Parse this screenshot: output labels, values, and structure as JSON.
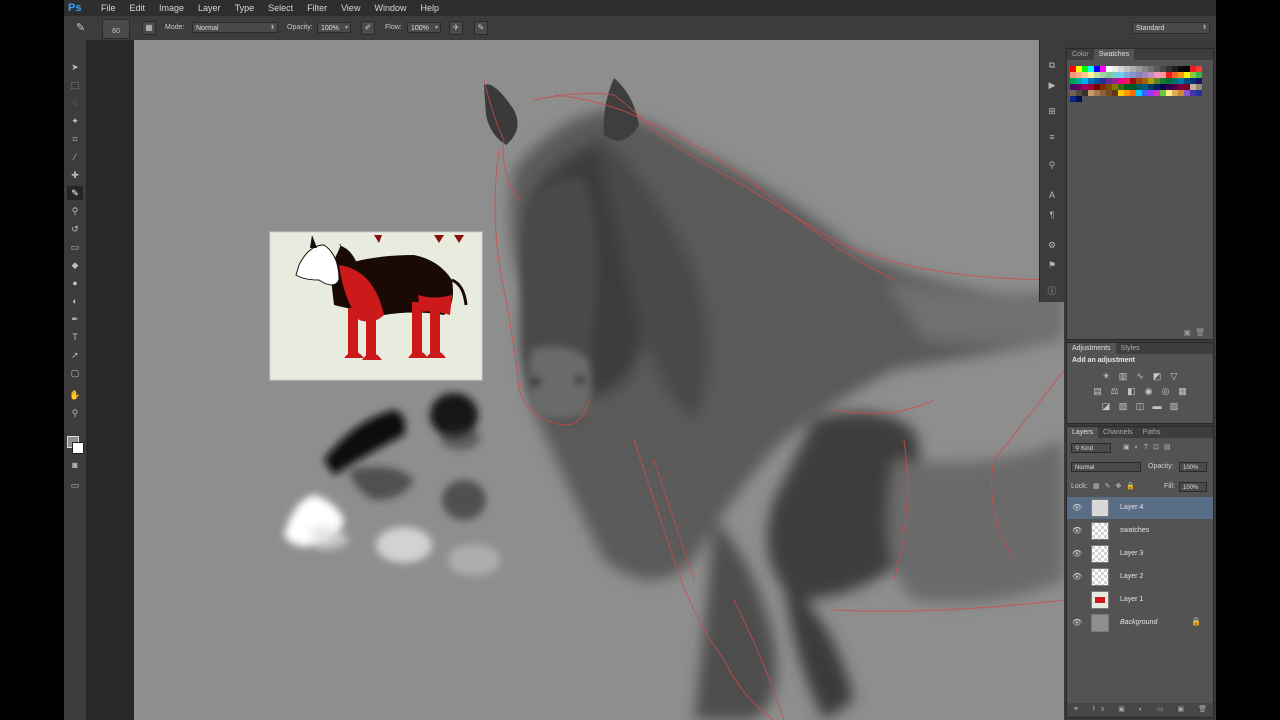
{
  "app": {
    "logo": "Ps"
  },
  "menus": [
    "File",
    "Edit",
    "Image",
    "Layer",
    "Type",
    "Select",
    "Filter",
    "View",
    "Window",
    "Help"
  ],
  "options": {
    "brush_size": "60",
    "mode_label": "Mode:",
    "mode_value": "Normal",
    "opacity_label": "Opacity:",
    "opacity_value": "100%",
    "flow_label": "Flow:",
    "flow_value": "100%",
    "workspace": "Standard"
  },
  "swatches_panel": {
    "tabs": [
      "Color",
      "Swatches"
    ],
    "active_tab": "Swatches"
  },
  "adjustments_panel": {
    "tabs": [
      "Adjustments",
      "Styles"
    ],
    "title": "Add an adjustment"
  },
  "layers_panel": {
    "tabs": [
      "Layers",
      "Channels",
      "Paths"
    ],
    "kind_filter": "Kind",
    "blend_mode": "Normal",
    "opacity_label": "Opacity:",
    "opacity_value": "100%",
    "lock_label": "Lock:",
    "fill_label": "Fill:",
    "fill_value": "100%",
    "layers": [
      {
        "name": "Layer 4",
        "visible": true,
        "selected": true
      },
      {
        "name": "swatches",
        "visible": true,
        "selected": false
      },
      {
        "name": "Layer 3",
        "visible": true,
        "selected": false
      },
      {
        "name": "Layer 2",
        "visible": true,
        "selected": false
      },
      {
        "name": "Layer 1",
        "visible": false,
        "selected": false
      },
      {
        "name": "Background",
        "visible": true,
        "selected": false
      }
    ]
  },
  "icons": {
    "brush": "brush-icon",
    "eye": "eye-icon",
    "lock": "lock-icon"
  }
}
